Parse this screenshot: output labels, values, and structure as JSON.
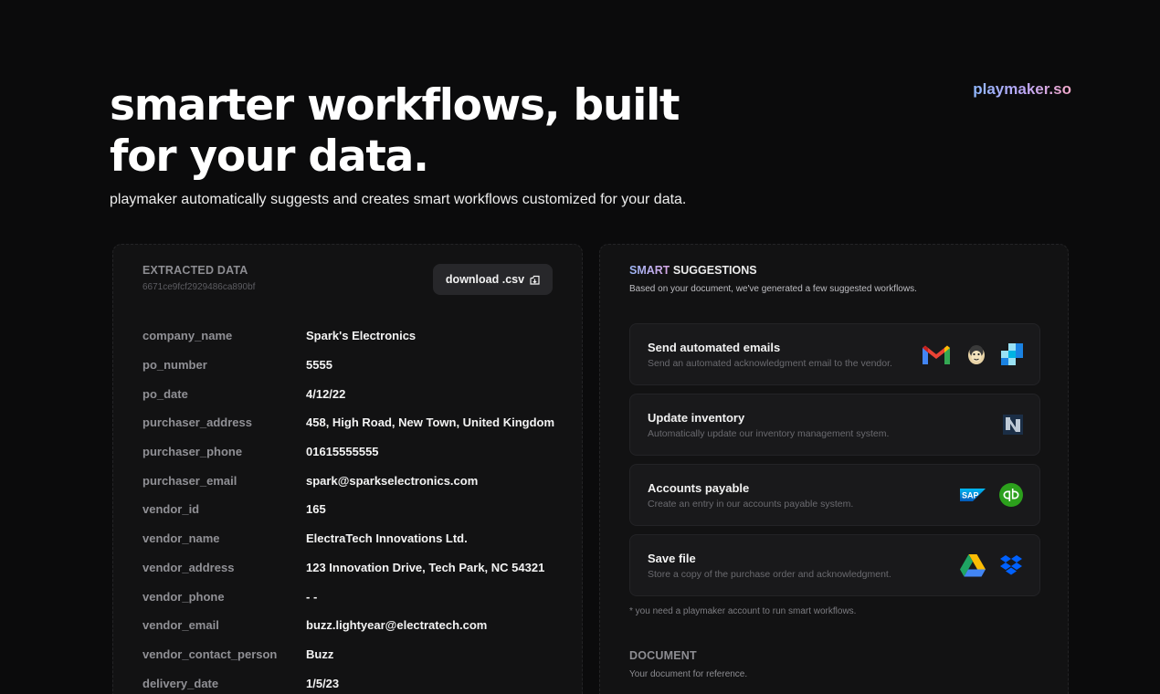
{
  "brand": {
    "name": "playmaker.so"
  },
  "hero": {
    "title": "smarter workflows, built for your data.",
    "subtitle": "playmaker automatically suggests and creates smart workflows customized for your data."
  },
  "extracted": {
    "label": "EXTRACTED DATA",
    "hash": "6671ce9fcf2929486ca890bf",
    "download_label": "download .csv",
    "rows": [
      {
        "key": "company_name",
        "value": "Spark's Electronics"
      },
      {
        "key": "po_number",
        "value": "5555"
      },
      {
        "key": "po_date",
        "value": "4/12/22"
      },
      {
        "key": "purchaser_address",
        "value": "458, High Road, New Town, United Kingdom"
      },
      {
        "key": "purchaser_phone",
        "value": "01615555555"
      },
      {
        "key": "purchaser_email",
        "value": "spark@sparkselectronics.com"
      },
      {
        "key": "vendor_id",
        "value": "165"
      },
      {
        "key": "vendor_name",
        "value": "ElectraTech Innovations Ltd."
      },
      {
        "key": "vendor_address",
        "value": "123 Innovation Drive, Tech Park, NC 54321"
      },
      {
        "key": "vendor_phone",
        "value": "- -"
      },
      {
        "key": "vendor_email",
        "value": "buzz.lightyear@electratech.com"
      },
      {
        "key": "vendor_contact_person",
        "value": "Buzz"
      },
      {
        "key": "delivery_date",
        "value": "1/5/23"
      }
    ]
  },
  "suggestions": {
    "label_smart": "SMART",
    "label_rest": " SUGGESTIONS",
    "description": "Based on your document, we've generated a few suggested workflows.",
    "cards": [
      {
        "title": "Send automated emails",
        "desc": "Send an automated acknowledgment email to the vendor.",
        "logos": [
          "gmail-icon",
          "mailchimp-icon",
          "sendgrid-icon"
        ]
      },
      {
        "title": "Update inventory",
        "desc": "Automatically update our inventory management system.",
        "logos": [
          "netsuite-icon"
        ]
      },
      {
        "title": "Accounts payable",
        "desc": "Create an entry in our accounts payable system.",
        "logos": [
          "sap-icon",
          "quickbooks-icon"
        ]
      },
      {
        "title": "Save file",
        "desc": "Store a copy of the purchase order and acknowledgment.",
        "logos": [
          "google-drive-icon",
          "dropbox-icon"
        ]
      }
    ],
    "note": "* you need a playmaker account to run smart workflows."
  },
  "document": {
    "label": "DOCUMENT",
    "description": "Your document for reference."
  },
  "colors": {
    "background": "#0b0b0c",
    "panel": "#121213",
    "card": "#19191b",
    "gmail_red": "#EA4335",
    "quickbooks_green": "#2CA01C",
    "sap_blue": "#0a6ed1",
    "dropbox_blue": "#0061FF"
  }
}
